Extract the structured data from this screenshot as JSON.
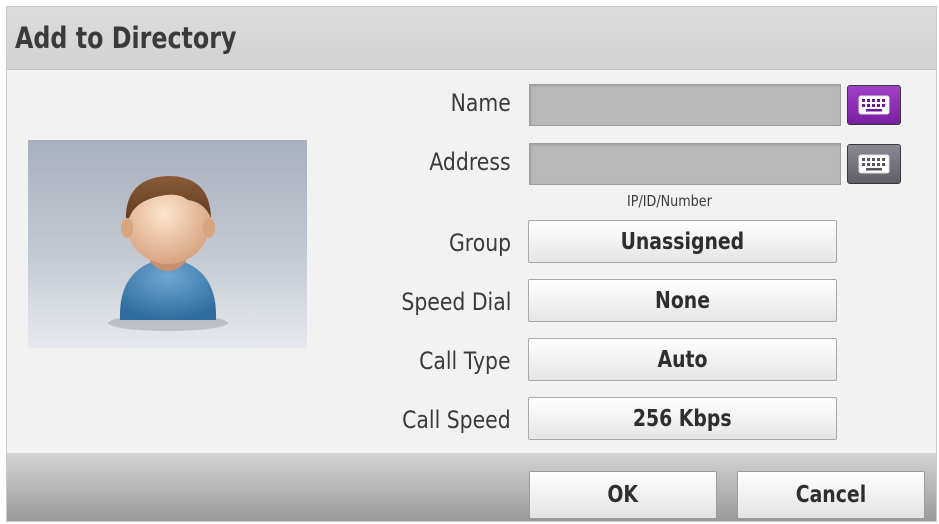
{
  "dialog": {
    "title": "Add to Directory"
  },
  "avatar": {
    "icon": "person-avatar-icon"
  },
  "form": {
    "name_label": "Name",
    "name_value": "",
    "address_label": "Address",
    "address_value": "",
    "address_hint": "IP/ID/Number",
    "group_label": "Group",
    "group_value": "Unassigned",
    "speed_dial_label": "Speed Dial",
    "speed_dial_value": "None",
    "call_type_label": "Call Type",
    "call_type_value": "Auto",
    "call_speed_label": "Call Speed",
    "call_speed_value": "256 Kbps"
  },
  "buttons": {
    "ok": "OK",
    "cancel": "Cancel"
  },
  "colors": {
    "keyboard_active": "#8e2db8",
    "keyboard_inactive": "#6b6b74",
    "field_bg": "#b9b9b9"
  }
}
